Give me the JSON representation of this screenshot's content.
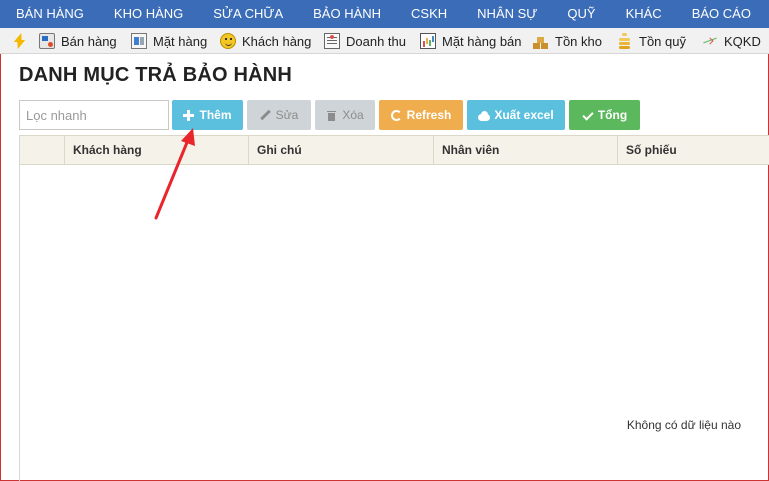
{
  "top_menu": [
    "BÁN HÀNG",
    "KHO HÀNG",
    "SỬA CHỮA",
    "BẢO HÀNH",
    "CSKH",
    "NHÂN SỰ",
    "QUỸ",
    "KHÁC",
    "BÁO CÁO"
  ],
  "sub_menu": [
    {
      "label": "Bán hàng",
      "icon": "sales-icon"
    },
    {
      "label": "Mặt hàng",
      "icon": "product-icon"
    },
    {
      "label": "Khách hàng",
      "icon": "customer-icon"
    },
    {
      "label": "Doanh thu",
      "icon": "revenue-icon"
    },
    {
      "label": "Mặt hàng bán",
      "icon": "bestseller-chart-icon"
    },
    {
      "label": "Tồn kho",
      "icon": "stock-icon"
    },
    {
      "label": "Tồn quỹ",
      "icon": "fund-coins-icon"
    },
    {
      "label": "KQKD",
      "icon": "business-result-icon"
    }
  ],
  "page": {
    "title": "DANH MỤC TRẢ BẢO HÀNH",
    "filter_placeholder": "Lọc nhanh"
  },
  "toolbar": {
    "add_label": "Thêm",
    "edit_label": "Sửa",
    "delete_label": "Xóa",
    "refresh_label": "Refresh",
    "export_label": "Xuất excel",
    "total_label": "Tổng"
  },
  "table": {
    "columns": [
      "Khách hàng",
      "Ghi chú",
      "Nhân viên",
      "Số phiếu"
    ],
    "rows": [],
    "empty_message": "Không có dữ liệu nào"
  },
  "colors": {
    "nav_bg": "#3a6cb7",
    "info": "#5bc0de",
    "warning": "#f0ad4e",
    "success": "#5cb85c",
    "disabled": "#cfd4d8",
    "annotation_arrow": "#e8262b"
  }
}
